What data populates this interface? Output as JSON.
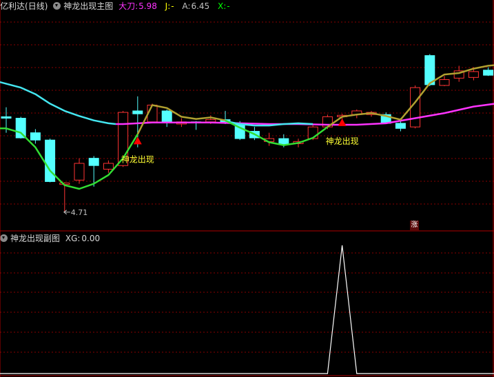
{
  "header": {
    "app_title": "亿利达",
    "period": "(日线)",
    "main_chart_name": "神龙出现主图",
    "indicators": [
      {
        "label": "大刀:",
        "value": "5.98",
        "color": "#ff33ff"
      },
      {
        "label": "J:",
        "value": "-",
        "color": "#ffff00"
      },
      {
        "label": "A:",
        "value": "6.45",
        "color": "#c0c0c0"
      },
      {
        "label": "X:",
        "value": "-",
        "color": "#00ff00"
      }
    ]
  },
  "sub_header": {
    "sub_chart_name": "神龙出现副图",
    "xg_label": "XG:",
    "xg_value": "0.00"
  },
  "annotations": {
    "low_price": "4.71",
    "signal_text_1": "神龙出现",
    "signal_text_2": "神龙出现",
    "badge": "涨"
  },
  "colors": {
    "up": "#ff3333",
    "down": "#54ffff",
    "cyan_line": "#44e6f0",
    "magenta_line": "#ff33ff",
    "green_line": "#33dd33",
    "olive_line": "#b0a030",
    "grid": "#8b0000",
    "signal_marker": "#ff0000",
    "signal_text": "#ffff33"
  },
  "chart_data": [
    {
      "type": "candlestick",
      "title": "神龙出现主图",
      "ylim": [
        4.5,
        7.5
      ],
      "candles": [
        {
          "o": 6.02,
          "h": 6.15,
          "l": 5.8,
          "c": 6.0
        },
        {
          "o": 6.0,
          "h": 6.02,
          "l": 5.72,
          "c": 5.73
        },
        {
          "o": 5.8,
          "h": 5.85,
          "l": 5.65,
          "c": 5.7
        },
        {
          "o": 5.7,
          "h": 5.72,
          "l": 5.12,
          "c": 5.13
        },
        {
          "o": 5.09,
          "h": 5.12,
          "l": 4.71,
          "c": 5.11
        },
        {
          "o": 5.15,
          "h": 5.45,
          "l": 5.1,
          "c": 5.38
        },
        {
          "o": 5.45,
          "h": 5.48,
          "l": 5.06,
          "c": 5.35
        },
        {
          "o": 5.3,
          "h": 5.42,
          "l": 5.25,
          "c": 5.38
        },
        {
          "o": 5.35,
          "h": 6.1,
          "l": 5.33,
          "c": 6.08
        },
        {
          "o": 6.1,
          "h": 6.3,
          "l": 5.6,
          "c": 6.06
        },
        {
          "o": 5.95,
          "h": 6.2,
          "l": 5.95,
          "c": 6.18
        },
        {
          "o": 6.1,
          "h": 6.12,
          "l": 5.88,
          "c": 5.95
        },
        {
          "o": 5.92,
          "h": 6.0,
          "l": 5.88,
          "c": 5.95
        },
        {
          "o": 5.95,
          "h": 5.96,
          "l": 5.84,
          "c": 5.94
        },
        {
          "o": 5.95,
          "h": 6.04,
          "l": 5.92,
          "c": 5.98
        },
        {
          "o": 5.98,
          "h": 6.1,
          "l": 5.92,
          "c": 5.95
        },
        {
          "o": 5.93,
          "h": 5.96,
          "l": 5.7,
          "c": 5.72
        },
        {
          "o": 5.82,
          "h": 5.88,
          "l": 5.7,
          "c": 5.73
        },
        {
          "o": 5.68,
          "h": 5.8,
          "l": 5.62,
          "c": 5.72
        },
        {
          "o": 5.72,
          "h": 5.78,
          "l": 5.6,
          "c": 5.64
        },
        {
          "o": 5.65,
          "h": 5.72,
          "l": 5.6,
          "c": 5.68
        },
        {
          "o": 5.72,
          "h": 5.92,
          "l": 5.7,
          "c": 5.88
        },
        {
          "o": 5.88,
          "h": 6.05,
          "l": 5.85,
          "c": 6.02
        },
        {
          "o": 6.02,
          "h": 6.06,
          "l": 5.96,
          "c": 6.04
        },
        {
          "o": 6.05,
          "h": 6.12,
          "l": 6.0,
          "c": 6.1
        },
        {
          "o": 6.05,
          "h": 6.1,
          "l": 6.02,
          "c": 6.08
        },
        {
          "o": 6.05,
          "h": 6.08,
          "l": 5.92,
          "c": 5.93
        },
        {
          "o": 5.93,
          "h": 6.0,
          "l": 5.82,
          "c": 5.86
        },
        {
          "o": 5.88,
          "h": 6.45,
          "l": 5.86,
          "c": 6.42
        },
        {
          "o": 6.86,
          "h": 6.88,
          "l": 6.44,
          "c": 6.46
        },
        {
          "o": 6.45,
          "h": 6.58,
          "l": 6.44,
          "c": 6.53
        },
        {
          "o": 6.55,
          "h": 6.72,
          "l": 6.5,
          "c": 6.65
        },
        {
          "o": 6.56,
          "h": 6.7,
          "l": 6.52,
          "c": 6.64
        },
        {
          "o": 6.66,
          "h": 6.7,
          "l": 6.58,
          "c": 6.59
        }
      ],
      "series": [
        {
          "type": "line",
          "color_key": "cyan_line",
          "points": [
            [
              -0.5,
              6.5
            ],
            [
              1,
              6.42
            ],
            [
              2,
              6.33
            ],
            [
              3,
              6.2
            ],
            [
              4,
              6.1
            ],
            [
              5,
              6.03
            ],
            [
              6,
              5.97
            ],
            [
              7,
              5.93
            ],
            [
              7.5,
              5.92
            ]
          ]
        },
        {
          "type": "line",
          "color_key": "magenta_line",
          "points": [
            [
              7.5,
              5.92
            ],
            [
              8,
              5.92
            ],
            [
              10,
              5.94
            ],
            [
              12,
              5.94
            ],
            [
              14,
              5.94
            ],
            [
              16,
              5.93
            ],
            [
              18,
              5.92
            ],
            [
              20,
              5.92
            ],
            [
              22,
              5.91
            ],
            [
              24,
              5.91
            ],
            [
              26,
              5.93
            ],
            [
              28,
              6.0
            ],
            [
              30,
              6.07
            ],
            [
              32,
              6.16
            ],
            [
              33.5,
              6.2
            ]
          ]
        },
        {
          "type": "line",
          "color_key": "cyan_line",
          "points": [
            [
              15,
              5.96
            ],
            [
              16,
              5.92
            ],
            [
              17,
              5.9
            ],
            [
              18,
              5.9
            ],
            [
              19,
              5.92
            ],
            [
              20,
              5.93
            ],
            [
              21,
              5.92
            ]
          ]
        },
        {
          "type": "line",
          "color_key": "green_line",
          "points": [
            [
              -0.5,
              5.86
            ],
            [
              0,
              5.86
            ],
            [
              1,
              5.8
            ],
            [
              2,
              5.6
            ],
            [
              3,
              5.28
            ],
            [
              4,
              5.08
            ],
            [
              5,
              5.03
            ],
            [
              6,
              5.1
            ],
            [
              7,
              5.22
            ],
            [
              8,
              5.45
            ],
            [
              9,
              5.78
            ]
          ]
        },
        {
          "type": "line",
          "color_key": "olive_line",
          "points": [
            [
              9,
              5.78
            ],
            [
              10,
              6.18
            ],
            [
              11,
              6.14
            ],
            [
              12,
              6.02
            ],
            [
              13,
              5.99
            ],
            [
              14,
              6.01
            ],
            [
              15,
              5.97
            ]
          ]
        },
        {
          "type": "line",
          "color_key": "green_line",
          "points": [
            [
              15,
              5.97
            ],
            [
              16,
              5.87
            ],
            [
              17,
              5.78
            ],
            [
              18,
              5.67
            ],
            [
              19,
              5.63
            ],
            [
              20,
              5.66
            ],
            [
              21,
              5.73
            ],
            [
              22,
              5.88
            ]
          ]
        },
        {
          "type": "line",
          "color_key": "olive_line",
          "points": [
            [
              22,
              5.88
            ],
            [
              23,
              6.02
            ],
            [
              24,
              6.05
            ],
            [
              25,
              6.07
            ],
            [
              26,
              6.03
            ],
            [
              27,
              5.98
            ],
            [
              28,
              6.22
            ],
            [
              29,
              6.48
            ],
            [
              30,
              6.6
            ],
            [
              31,
              6.62
            ],
            [
              32,
              6.68
            ],
            [
              33,
              6.72
            ],
            [
              33.5,
              6.73
            ]
          ]
        }
      ],
      "signals": [
        {
          "index": 9,
          "price": 5.68,
          "label_key": "signal_text_1"
        },
        {
          "index": 23,
          "price": 5.93,
          "label_key": "signal_text_2"
        }
      ],
      "low_marker": {
        "index": 4,
        "price": 4.71
      }
    },
    {
      "type": "line",
      "title": "神龙出现副图",
      "series": [
        {
          "name": "XG",
          "values_by_index": {
            "23": 1
          }
        }
      ],
      "ylim": [
        0,
        1
      ]
    }
  ]
}
